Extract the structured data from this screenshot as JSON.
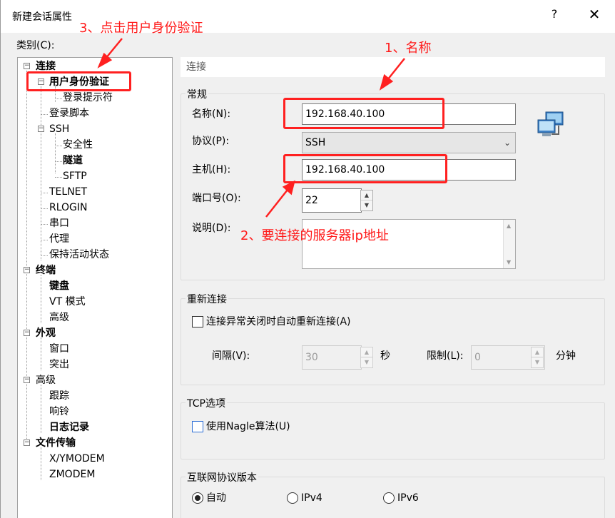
{
  "window": {
    "title": "新建会话属性",
    "help": "?",
    "close": "✕"
  },
  "category_label": "类别(C):",
  "tree": {
    "connection": "连接",
    "auth": "用户身份验证",
    "login_prompts": "登录提示符",
    "login_scripts": "登录脚本",
    "ssh": "SSH",
    "security": "安全性",
    "tunneling": "隧道",
    "sftp": "SFTP",
    "telnet": "TELNET",
    "rlogin": "RLOGIN",
    "serial": "串口",
    "proxy": "代理",
    "keepalive": "保持活动状态",
    "terminal": "终端",
    "keyboard": "键盘",
    "vt_modes": "VT 模式",
    "advanced": "高级",
    "appearance": "外观",
    "window": "窗口",
    "highlight": "突出",
    "advanced2": "高级",
    "trace": "跟踪",
    "bell": "响铃",
    "logging": "日志记录",
    "file_transfer": "文件传输",
    "xymodem": "X/YMODEM",
    "zmodem": "ZMODEM"
  },
  "panel": {
    "header": "连接",
    "general": {
      "title": "常规",
      "name_label": "名称(N):",
      "name_value": "192.168.40.100",
      "protocol_label": "协议(P):",
      "protocol_value": "SSH",
      "host_label": "主机(H):",
      "host_value": "192.168.40.100",
      "port_label": "端口号(O):",
      "port_value": "22",
      "desc_label": "说明(D):"
    },
    "reconnect": {
      "title": "重新连接",
      "checkbox_label": "连接异常关闭时自动重新连接(A)",
      "interval_label": "间隔(V):",
      "interval_value": "30",
      "seconds": "秒",
      "limit_label": "限制(L):",
      "limit_value": "0",
      "minutes": "分钟"
    },
    "tcp": {
      "title": "TCP选项",
      "nagle_label": "使用Nagle算法(U)"
    },
    "ip_version": {
      "title": "互联网协议版本",
      "auto": "自动",
      "ipv4": "IPv4",
      "ipv6": "IPv6"
    }
  },
  "annotations": {
    "step1": "1、名称",
    "step2": "2、要连接的服务器ip地址",
    "step3": "3、点击用户身份验证"
  },
  "colors": {
    "annotation": "#ff2020",
    "dialog_bg": "#f0f0f0"
  }
}
